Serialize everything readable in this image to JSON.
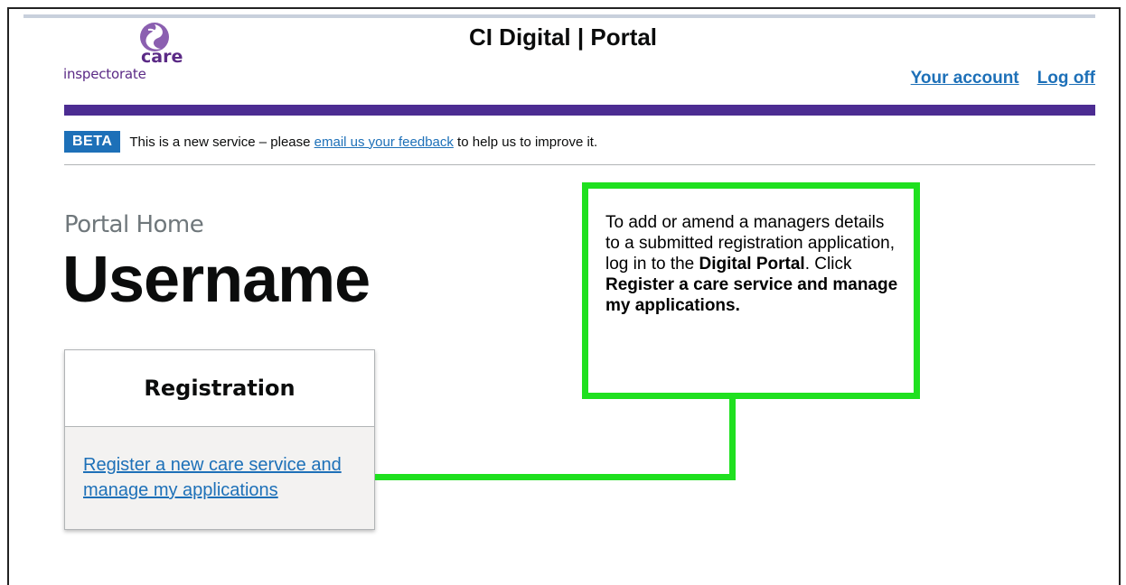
{
  "header": {
    "logo_care": "care",
    "logo_inspectorate": "inspectorate",
    "site_title": "CI Digital | Portal",
    "account_link": "Your account",
    "logoff_link": "Log off"
  },
  "beta_banner": {
    "tag": "BETA",
    "text_before": "This is a new service – please ",
    "link": "email us your feedback",
    "text_after": " to help us to improve it."
  },
  "page": {
    "caption": "Portal Home",
    "heading": "Username"
  },
  "registration_card": {
    "title": "Registration",
    "link": "Register a new care service and manage my applications"
  },
  "callout": {
    "text_1": "To add or amend a managers details to a submitted registration application, log in to the ",
    "bold_1": "Digital Portal",
    "text_2": ". Click ",
    "bold_2": "Register a care service and manage my applications."
  },
  "colors": {
    "brand_purple": "#4c2c92",
    "link_blue": "#1d70b8",
    "annotation_green": "#1fe01f"
  },
  "icons": [
    "care-inspectorate-logo-icon"
  ]
}
